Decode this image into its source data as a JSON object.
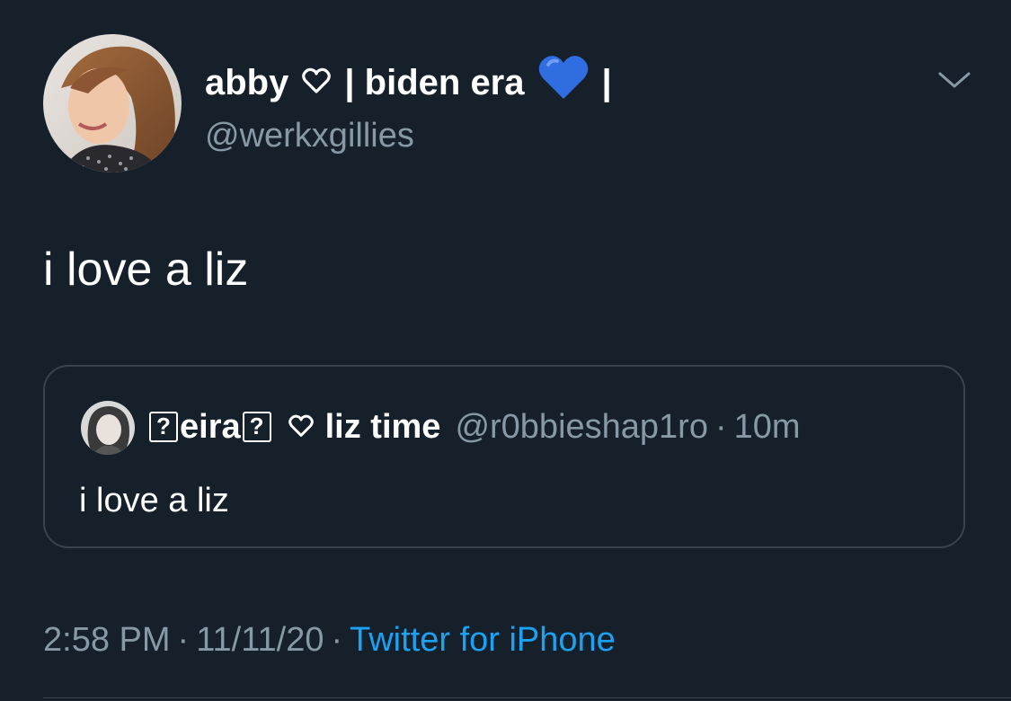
{
  "tweet": {
    "display_name_part1": "abby",
    "display_name_part2": "| biden era",
    "display_name_part3": "|",
    "handle": "@werkxgillies",
    "text": "i love a liz",
    "timestamp": "2:58 PM",
    "date": "11/11/20",
    "separator": "·",
    "source": "Twitter for iPhone"
  },
  "quote": {
    "name_part1": "eira",
    "name_part2": "liz time",
    "missing_glyph": "?",
    "handle": "@r0bbieshap1ro",
    "separator": "·",
    "time_ago": "10m",
    "text": "i love a liz"
  },
  "icons": {
    "outline_heart": "heart-outline-icon",
    "blue_heart": "blue-heart-emoji",
    "chevron": "chevron-down-icon"
  },
  "colors": {
    "background": "#15202b",
    "secondary_text": "#8899a6",
    "link": "#1da1f2",
    "border": "#38444d",
    "blue_heart": "#2f6de0"
  }
}
